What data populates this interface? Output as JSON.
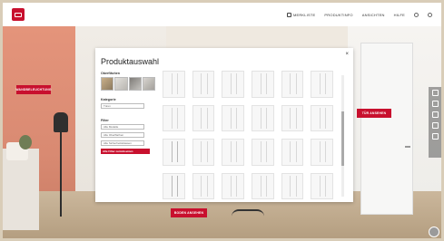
{
  "header": {
    "nav": [
      "MERKLISTE",
      "PRODUKTINFO",
      "ANSICHTEN",
      "HILFE"
    ],
    "colors": {
      "brand": "#c8102e"
    }
  },
  "scene": {
    "hotspots": {
      "left": "WANDBELEUCHTUNG",
      "right": "TÜR ANSEHEN",
      "bottom": "BODEN ANSEHEN"
    }
  },
  "modal": {
    "title": "Produktauswahl",
    "close": "×",
    "filters": {
      "finish_label": "Oberflächen",
      "category_label": "Kategorie",
      "category_value": "Türen",
      "filter_label": "Filter",
      "options": [
        "Alle Modelle",
        "Alle Oberflächen",
        "Alle Sicherheitsklassen"
      ],
      "reset": "Alle Filter zurücksetzen"
    },
    "grid_count": 24
  }
}
